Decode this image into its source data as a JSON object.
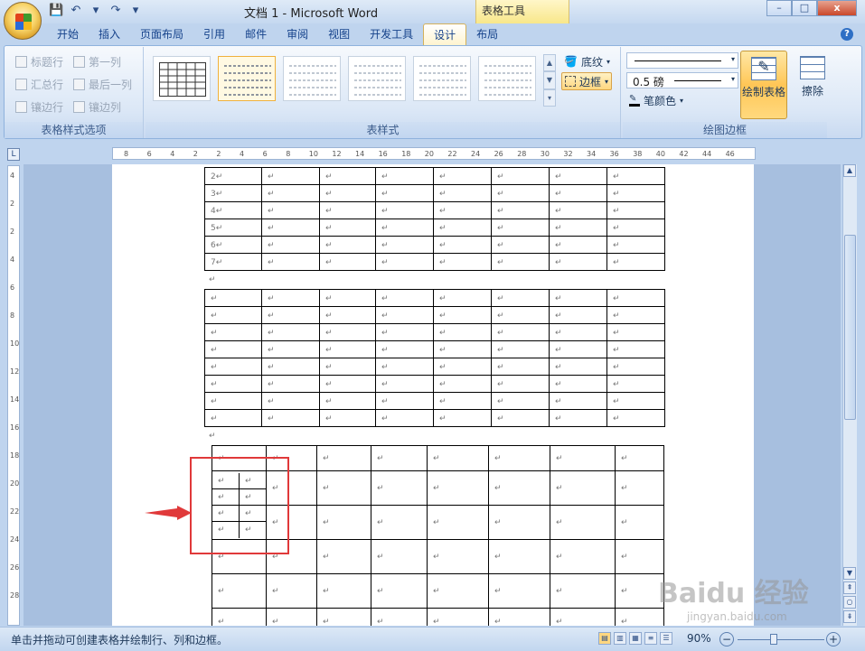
{
  "window": {
    "title": "文档 1 - Microsoft Word",
    "contextual_title": "表格工具",
    "controls": [
      "–",
      "□",
      "x"
    ]
  },
  "qat": {
    "save": "💾",
    "undo": "↶",
    "redo": "↷",
    "dropdown": "▾"
  },
  "tabs": [
    {
      "label": "开始"
    },
    {
      "label": "插入"
    },
    {
      "label": "页面布局"
    },
    {
      "label": "引用"
    },
    {
      "label": "邮件"
    },
    {
      "label": "审阅"
    },
    {
      "label": "视图"
    },
    {
      "label": "开发工具"
    },
    {
      "label": "设计",
      "active": true
    },
    {
      "label": "布局"
    }
  ],
  "ribbon": {
    "style_options": {
      "label": "表格样式选项",
      "items": [
        "标题行",
        "第一列",
        "汇总行",
        "最后一列",
        "镶边行",
        "镶边列"
      ]
    },
    "table_styles": {
      "label": "表样式",
      "shading": "底纹",
      "borders": "边框"
    },
    "draw_borders": {
      "label": "绘图边框",
      "line_weight": "0.5 磅",
      "pen_color": "笔颜色",
      "draw_table": "绘制表格",
      "eraser": "擦除"
    }
  },
  "ruler": {
    "h_ticks": [
      "8",
      "6",
      "4",
      "2",
      "2",
      "4",
      "6",
      "8",
      "10",
      "12",
      "14",
      "16",
      "18",
      "20",
      "22",
      "24",
      "26",
      "28",
      "30",
      "32",
      "34",
      "36",
      "38",
      "40",
      "42",
      "44",
      "46"
    ],
    "v_ticks": [
      "4",
      "2",
      "2",
      "4",
      "6",
      "8",
      "10",
      "12",
      "14",
      "16",
      "18",
      "20",
      "22",
      "24",
      "26",
      "28"
    ]
  },
  "document": {
    "table1_rows": [
      "2",
      "3",
      "4",
      "5",
      "6",
      "7"
    ],
    "para_mark": "↵"
  },
  "status": {
    "text": "单击并拖动可创建表格并绘制行、列和边框。",
    "zoom": "90%"
  },
  "watermark": {
    "text": "Baidu 经验",
    "sub": "jingyan.baidu.com"
  },
  "colors": {
    "accent": "#f0b13d",
    "annotation": "#e0393a"
  }
}
